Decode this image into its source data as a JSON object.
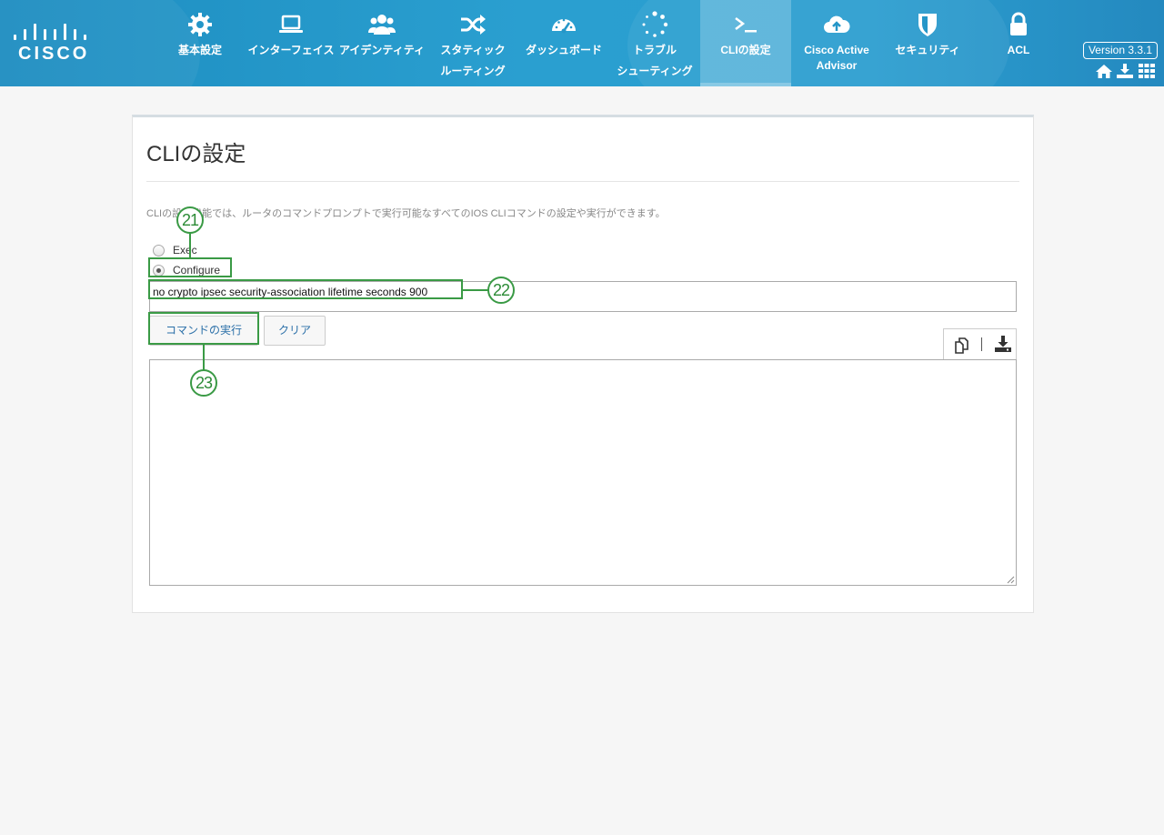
{
  "header": {
    "logo_text": "CISCO",
    "version": "Version 3.3.1",
    "nav": [
      {
        "label_line1": "基本設定",
        "label_line2": "",
        "icon": "gear-icon"
      },
      {
        "label_line1": "インターフェイス",
        "label_line2": "",
        "icon": "laptop-icon"
      },
      {
        "label_line1": "アイデンティティ",
        "label_line2": "",
        "icon": "users-icon"
      },
      {
        "label_line1": "スタティック",
        "label_line2": "ルーティング",
        "icon": "shuffle-icon"
      },
      {
        "label_line1": "ダッシュボード",
        "label_line2": "",
        "icon": "dashboard-icon"
      },
      {
        "label_line1": "トラブル",
        "label_line2": "シューティング",
        "icon": "spinner-icon"
      },
      {
        "label_line1": "CLIの設定",
        "label_line2": "",
        "icon": "terminal-icon",
        "active": true
      },
      {
        "label_line1": "Cisco Active",
        "label_line2": "Advisor",
        "icon": "cloud-upload-icon"
      },
      {
        "label_line1": "セキュリティ",
        "label_line2": "",
        "icon": "shield-icon"
      },
      {
        "label_line1": "ACL",
        "label_line2": "",
        "icon": "lock-icon"
      }
    ],
    "util_icons": [
      "home-icon",
      "download-icon",
      "apps-grid-icon"
    ]
  },
  "panel": {
    "title": "CLIの設定",
    "description": "CLIの設定機能では、ルータのコマンドプロンプトで実行可能なすべてのIOS CLIコマンドの設定や実行ができます。",
    "mode_options": [
      {
        "label": "Exec",
        "checked": false
      },
      {
        "label": "Configure",
        "checked": true
      }
    ],
    "command_value": "no crypto ipsec security-association lifetime seconds 900",
    "run_button": "コマンドの実行",
    "clear_button": "クリア",
    "output_tools": [
      "copy-icon",
      "download-icon"
    ],
    "output_text": ""
  },
  "annotations": {
    "callout_21": "21",
    "callout_22": "22",
    "callout_23": "23",
    "color": "#3a9a45"
  }
}
